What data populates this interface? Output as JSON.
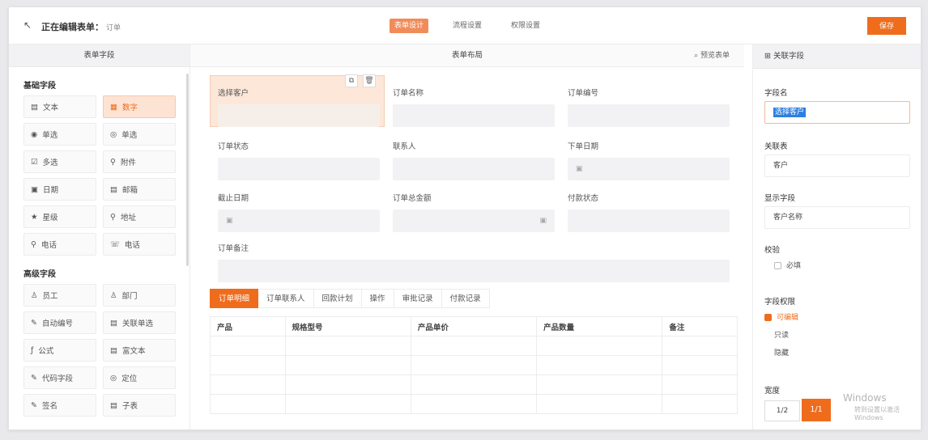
{
  "header": {
    "title": "正在编辑表单：",
    "subtitle": "订单",
    "tabs": [
      "表单设计",
      "流程设置",
      "权限设置"
    ],
    "save_label": "保存"
  },
  "left_panel": {
    "title": "表单字段",
    "basic_title": "基础字段",
    "basic_fields": [
      {
        "icon": "▤",
        "label": "文本"
      },
      {
        "icon": "▦",
        "label": "数字"
      },
      {
        "icon": "◉",
        "label": "单选"
      },
      {
        "icon": "◎",
        "label": "单选"
      },
      {
        "icon": "☑",
        "label": "多选"
      },
      {
        "icon": "⚲",
        "label": "附件"
      },
      {
        "icon": "▣",
        "label": "日期"
      },
      {
        "icon": "▤",
        "label": "邮箱"
      },
      {
        "icon": "★",
        "label": "星级"
      },
      {
        "icon": "⚲",
        "label": "地址"
      },
      {
        "icon": "⚲",
        "label": "电话"
      },
      {
        "icon": "☏",
        "label": "电话"
      }
    ],
    "advanced_title": "高级字段",
    "advanced_fields": [
      {
        "icon": "♙",
        "label": "员工"
      },
      {
        "icon": "♙",
        "label": "部门"
      },
      {
        "icon": "✎",
        "label": "自动编号"
      },
      {
        "icon": "▤",
        "label": "关联单选"
      },
      {
        "icon": "ƒ",
        "label": "公式"
      },
      {
        "icon": "▤",
        "label": "富文本"
      },
      {
        "icon": "✎",
        "label": "代码字段"
      },
      {
        "icon": "◎",
        "label": "定位"
      },
      {
        "icon": "✎",
        "label": "签名"
      },
      {
        "icon": "▤",
        "label": "子表"
      }
    ]
  },
  "center": {
    "title": "表单布局",
    "preview": "⌕ 预览表单",
    "fields": [
      {
        "label": "选择客户",
        "value": ""
      },
      {
        "label": "订单名称",
        "value": ""
      },
      {
        "label": "订单编号",
        "value": ""
      },
      {
        "label": "订单状态",
        "value": ""
      },
      {
        "label": "联系人",
        "value": ""
      },
      {
        "label": "下单日期",
        "value": "▣"
      },
      {
        "label": "截止日期",
        "value": "▣"
      },
      {
        "label": "订单总金额",
        "value": "▣"
      },
      {
        "label": "付款状态",
        "value": ""
      },
      {
        "label": "订单备注",
        "value": ""
      }
    ],
    "tool_copy": "⧉",
    "tool_delete": "🗑",
    "subtabs": [
      "订单明细",
      "订单联系人",
      "回款计划",
      "操作",
      "审批记录",
      "付款记录"
    ],
    "table_headers": [
      "产品",
      "规格型号",
      "产品单价",
      "产品数量",
      "备注"
    ]
  },
  "right": {
    "title": "⊞ 关联字段",
    "field_name_label": "字段名",
    "field_name_value": "选择客户",
    "relation_label": "关联表",
    "relation_value": "客户",
    "display_label": "显示字段",
    "display_value": "客户名称",
    "validate_label": "校验",
    "required_option": "必填",
    "perm_label": "字段权限",
    "perm_options": [
      "可编辑",
      "只读",
      "隐藏"
    ],
    "width_label": "宽度",
    "pager_left": "1/2",
    "pager_right": "1/1"
  },
  "watermark": {
    "line1": "Windows",
    "line2": "转到设置以激活 Windows"
  },
  "colors": {
    "accent": "#ef6c1d",
    "highlight": "#2f7fe0"
  }
}
